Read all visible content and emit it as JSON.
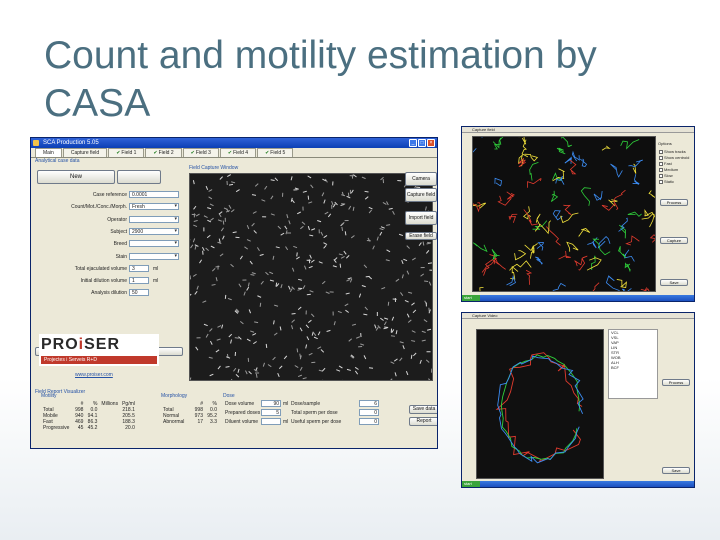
{
  "slide": {
    "title": "Count and motility estimation by CASA"
  },
  "window": {
    "title": "SCA Production 5.05",
    "tabs": [
      {
        "label": "Main",
        "checked": false
      },
      {
        "label": "Capture field",
        "checked": false
      },
      {
        "label": "Field 1",
        "checked": true
      },
      {
        "label": "Field 2",
        "checked": true
      },
      {
        "label": "Field 3",
        "checked": true
      },
      {
        "label": "Field 4",
        "checked": true
      },
      {
        "label": "Field 5",
        "checked": true
      }
    ],
    "left_group_label": "Analytical case data",
    "new_button": "New",
    "fields": [
      {
        "label": "Case reference",
        "value": "0.0001",
        "kind": "text"
      },
      {
        "label": "Count/Mot./Conc./Morph.",
        "value": "Fresh",
        "kind": "dropdown"
      },
      {
        "label": "Operator",
        "value": "",
        "kind": "dropdown"
      },
      {
        "label": "Subject",
        "value": "2900",
        "kind": "dropdown"
      },
      {
        "label": "Breed",
        "value": "",
        "kind": "dropdown"
      },
      {
        "label": "Stain",
        "value": "",
        "kind": "dropdown"
      },
      {
        "label": "Total ejaculated volume",
        "value": "3",
        "unit": "ml",
        "kind": "small"
      },
      {
        "label": "Initial dilution volume",
        "value": "1",
        "unit": "ml",
        "kind": "small"
      },
      {
        "label": "Analysis dilution",
        "value": "50",
        "kind": "small"
      }
    ],
    "setup_button": "Setup",
    "logo": {
      "text_pre": "PRO",
      "text_o": "i",
      "text_post": "SER",
      "subtitle": "Projectes i Serveis R+D"
    },
    "url": "www.proiser.com",
    "capture_label": "Field Capture Window",
    "side_buttons": [
      "Camera",
      "Capture field",
      "Import field",
      "Erase field"
    ],
    "results_label": "Field Report Visualizer",
    "motility": {
      "label": "Motility",
      "headers": [
        "",
        "#",
        "%",
        "Millions",
        "Pg/ml"
      ],
      "rows": [
        [
          "Total",
          "998",
          "0.0",
          "",
          "218.1"
        ],
        [
          "Mobile",
          "940",
          "94.1",
          "",
          "205.5"
        ],
        [
          "Fast",
          "469",
          "86.3",
          "",
          "188.3"
        ],
        [
          "Progressive",
          "45",
          "45.2",
          "",
          "20.0"
        ]
      ]
    },
    "morphology": {
      "label": "Morphology",
      "headers": [
        "",
        "#",
        "%"
      ],
      "rows": [
        [
          "Total",
          "998",
          "0.0"
        ],
        [
          "Normal",
          "973",
          "95.2"
        ],
        [
          "Abnormal",
          "17",
          "3.3"
        ]
      ]
    },
    "dose": {
      "label": "Dose",
      "rows": [
        {
          "label": "Dose volume",
          "value": "90",
          "unit": "ml",
          "label2": "Dose/sample",
          "value2": "6"
        },
        {
          "label": "Prepared doses",
          "value": "5",
          "unit": "",
          "label2": "Total sperm per dose",
          "value2": "0"
        },
        {
          "label": "Diluent volume",
          "value": "",
          "unit": "ml",
          "label2": "Useful sperm per dose",
          "value2": "0"
        }
      ]
    },
    "bottom_buttons": [
      "Save data",
      "Report"
    ]
  },
  "screenshot_top": {
    "title": "Capture field",
    "options_label": "Options",
    "checks": [
      "Show tracks",
      "Show centroid",
      "Fast",
      "Medium",
      "Slow",
      "Static"
    ],
    "buttons": [
      "Process",
      "Capture",
      "Save"
    ]
  },
  "screenshot_bottom": {
    "title": "Capture Video",
    "legend": [
      "VCL",
      "VSL",
      "VAP",
      "LIN",
      "STR",
      "WOB",
      "ALH",
      "BCF"
    ],
    "buttons": [
      "Process",
      "Save"
    ]
  }
}
